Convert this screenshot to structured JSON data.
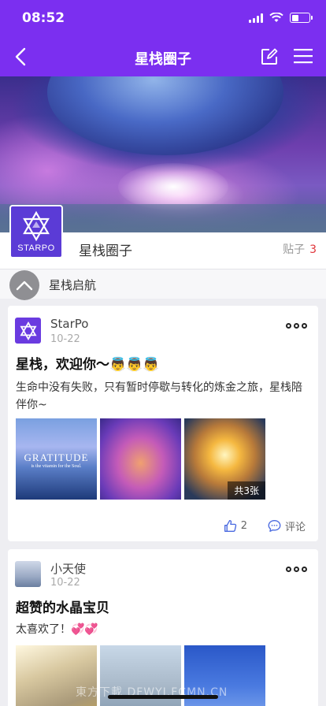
{
  "status_bar": {
    "time": "08:52"
  },
  "nav": {
    "title": "星栈圈子"
  },
  "circle": {
    "name": "星栈圈子",
    "logo_text": "STARPO",
    "post_label": "贴子",
    "post_count": "3"
  },
  "pinned": {
    "label": "星栈启航"
  },
  "posts": [
    {
      "author": "StarPo",
      "date": "10-22",
      "title": "星栈，欢迎你～👼👼👼",
      "body": "生命中没有失败，只有暂时停歇与转化的炼金之旅，星栈陪伴你~",
      "image1_caption": "GRATITUDE",
      "image1_subcaption": "is the vitamin for the Soul.",
      "image_count": "共3张",
      "likes": "2",
      "comment_label": "评论"
    },
    {
      "author": "小天使",
      "date": "10-22",
      "title": "超赞的水晶宝贝",
      "body": "太喜欢了！💞💞"
    }
  ],
  "watermark": "東方下載 DFWYJ.FCMN.CN"
}
